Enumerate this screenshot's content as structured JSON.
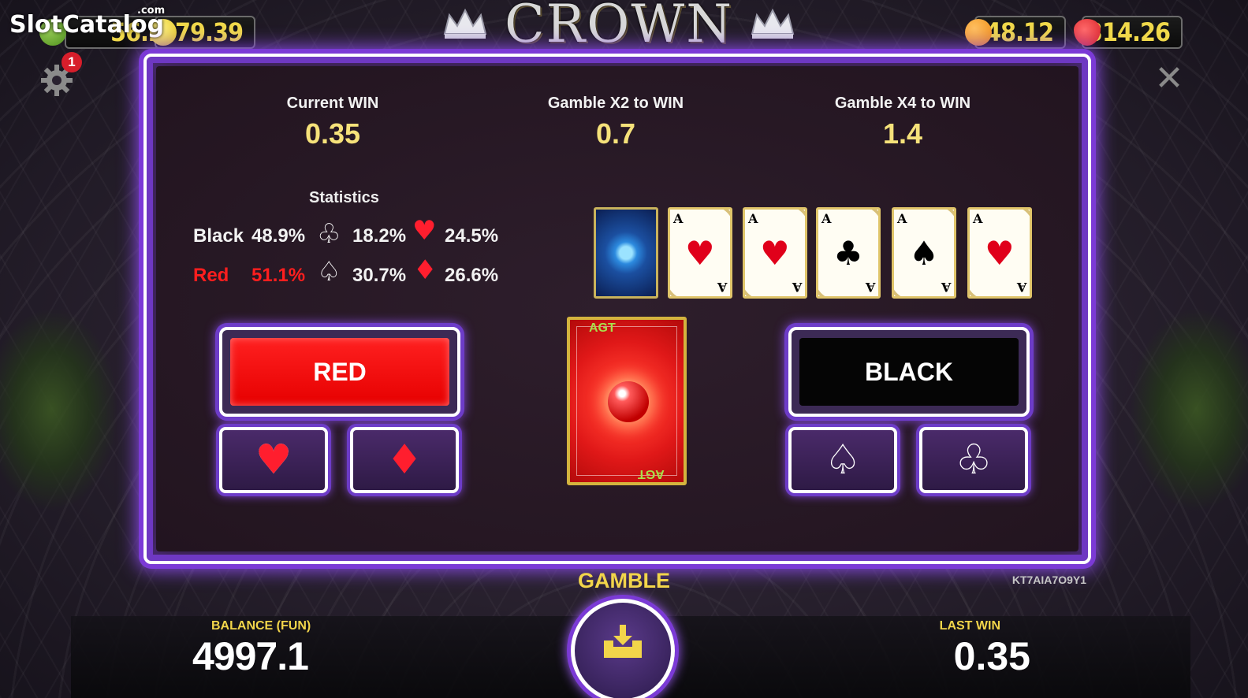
{
  "watermark": {
    "text": "SlotCatalog",
    "suffix": ".com"
  },
  "jackpots": [
    {
      "fruit": "apple-icon",
      "value": "56.26",
      "color": "#4e8f1c"
    },
    {
      "fruit": "lemon-icon",
      "value": "79.39",
      "color": "#e2c41c"
    },
    {
      "fruit": "orange-icon",
      "value": "48.12",
      "color": "#f08b12"
    },
    {
      "fruit": "strawberry-icon",
      "value": "314.26",
      "color": "#d61f26"
    }
  ],
  "logo": {
    "text": "CROWN"
  },
  "settings": {
    "badge": "1"
  },
  "close": {
    "symbol": "✕"
  },
  "wins": {
    "current": {
      "label": "Current WIN",
      "value": "0.35"
    },
    "x2": {
      "label": "Gamble X2 to WIN",
      "value": "0.7"
    },
    "x4": {
      "label": "Gamble X4 to WIN",
      "value": "1.4"
    }
  },
  "statistics": {
    "title": "Statistics",
    "black_label": "Black",
    "black_pct": "48.9%",
    "red_label": "Red",
    "red_pct": "51.1%",
    "clubs_pct": "18.2%",
    "hearts_pct": "24.5%",
    "spades_pct": "30.7%",
    "diamonds_pct": "26.6%"
  },
  "history": [
    {
      "type": "back"
    },
    {
      "rank": "A",
      "suit": "♥",
      "color": "#e0001a"
    },
    {
      "rank": "A",
      "suit": "♥",
      "color": "#e0001a"
    },
    {
      "rank": "A",
      "suit": "♣",
      "color": "#000000"
    },
    {
      "rank": "A",
      "suit": "♠",
      "color": "#000000"
    },
    {
      "rank": "A",
      "suit": "♥",
      "color": "#e0001a"
    }
  ],
  "card_back_brand": "AGT",
  "buttons": {
    "red": "RED",
    "black": "BLACK",
    "hearts": "♥",
    "diamonds": "♦",
    "spades": "♤",
    "clubs": "♧"
  },
  "bottom": {
    "gamble": "GAMBLE",
    "code": "KT7AIA7O9Y1",
    "balance_label": "BALANCE (FUN)",
    "balance_value": "4997.1",
    "lastwin_label": "LAST WIN",
    "lastwin_value": "0.35"
  },
  "colors": {
    "accent_purple": "#7b3ad6",
    "gold_text": "#f6e27a",
    "red_text": "#ff1e1e"
  }
}
